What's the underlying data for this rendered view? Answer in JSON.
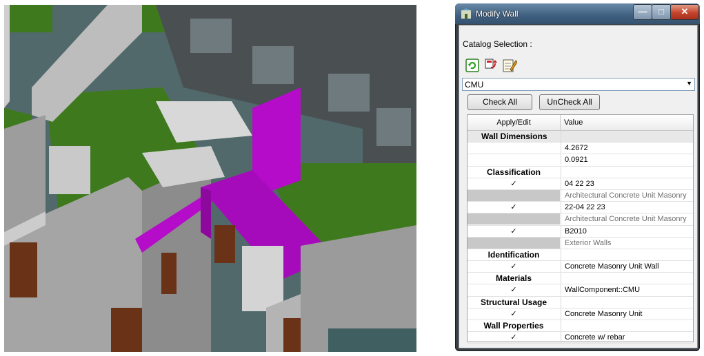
{
  "dialog": {
    "title": "Modify Wall",
    "catalog_label": "Catalog Selection :",
    "combo_value": "CMU",
    "buttons": {
      "check_all": "Check All",
      "uncheck_all": "UnCheck All"
    },
    "columns": {
      "apply": "Apply/Edit",
      "value": "Value"
    },
    "check_mark": "✓",
    "rows": [
      {
        "type": "section-top",
        "label": "Wall Dimensions",
        "value": ""
      },
      {
        "type": "value",
        "label": "",
        "value": "4.2672"
      },
      {
        "type": "value",
        "label": "",
        "value": "0.0921"
      },
      {
        "type": "section",
        "label": "Classification",
        "value": ""
      },
      {
        "type": "checked",
        "label": "✓",
        "value": "04 22 23"
      },
      {
        "type": "desc",
        "label": "",
        "value": "Architectural Concrete Unit Masonry"
      },
      {
        "type": "checked",
        "label": "✓",
        "value": "22-04 22 23"
      },
      {
        "type": "desc",
        "label": "",
        "value": "Architectural Concrete Unit Masonry"
      },
      {
        "type": "checked",
        "label": "✓",
        "value": "B2010"
      },
      {
        "type": "desc",
        "label": "",
        "value": "Exterior Walls"
      },
      {
        "type": "section",
        "label": "Identification",
        "value": ""
      },
      {
        "type": "checked",
        "label": "✓",
        "value": "Concrete Masonry Unit Wall"
      },
      {
        "type": "section",
        "label": "Materials",
        "value": ""
      },
      {
        "type": "checked",
        "label": "✓",
        "value": "WallComponent::CMU"
      },
      {
        "type": "section",
        "label": "Structural Usage",
        "value": ""
      },
      {
        "type": "checked",
        "label": "✓",
        "value": "Concrete Masonry Unit"
      },
      {
        "type": "section",
        "label": "Wall Properties",
        "value": ""
      },
      {
        "type": "checked",
        "label": "✓",
        "value": "Concrete w/ rebar"
      }
    ],
    "icons": [
      "refresh-icon",
      "export-icon",
      "edit-icon"
    ]
  },
  "colors": {
    "highlight_wall": "#b40cc8",
    "floor": "#3f7a1c",
    "wall": "#a8a8a8"
  }
}
